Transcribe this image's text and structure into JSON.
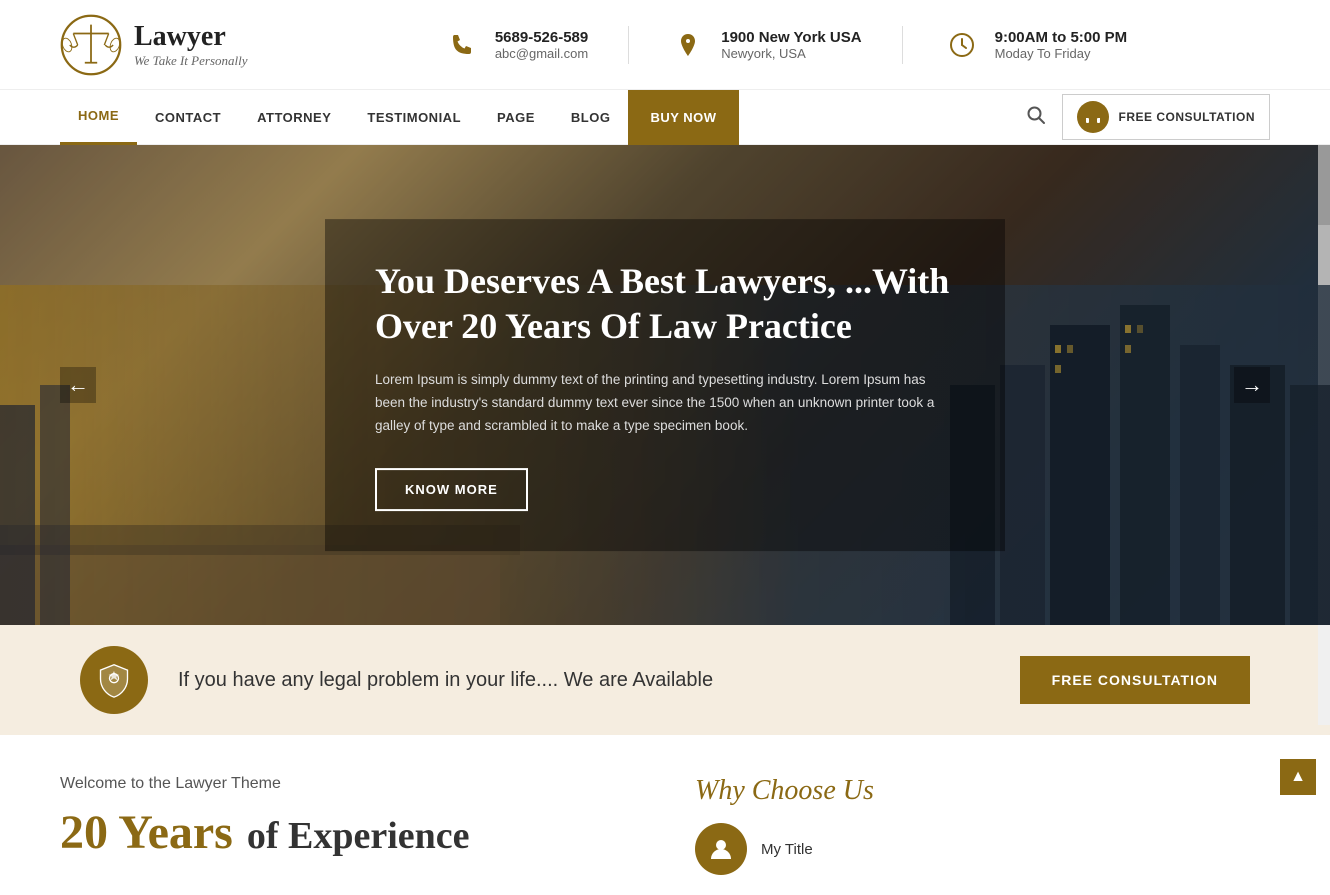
{
  "site": {
    "logo_title": "Lawyer",
    "logo_subtitle": "We Take It Personally"
  },
  "topbar": {
    "phone": {
      "number": "5689-526-589",
      "email": "abc@gmail.com"
    },
    "address": {
      "line1": "1900 New York USA",
      "line2": "Newyork, USA"
    },
    "hours": {
      "time": "9:00AM to 5:00 PM",
      "days": "Moday To Friday"
    }
  },
  "nav": {
    "items": [
      {
        "label": "HOME",
        "active": true
      },
      {
        "label": "CONTACT",
        "active": false
      },
      {
        "label": "ATTORNEY",
        "active": false
      },
      {
        "label": "TESTIMONIAL",
        "active": false
      },
      {
        "label": "PAGE",
        "active": false
      },
      {
        "label": "BLOG",
        "active": false
      }
    ],
    "buy_label": "BUY NOW",
    "consultation_label": "FREE CONSULTATION"
  },
  "hero": {
    "title": "You Deserves A Best Lawyers, ...With Over 20 Years Of Law Practice",
    "description": "Lorem Ipsum is simply dummy text of the printing and typesetting industry. Lorem Ipsum has been the industry's standard dummy text ever since the 1500 when an unknown printer took a galley of type and scrambled it to make a type specimen book.",
    "cta_label": "KNOW MORE",
    "arrow_left": "←",
    "arrow_right": "→"
  },
  "consult_strip": {
    "text": "If you have any legal problem in your life.... We are Available",
    "cta_label": "FREE CONSULTATION"
  },
  "bottom": {
    "welcome_title": "Welcome to the Lawyer Theme",
    "years_number": "20 Years",
    "years_suffix": "of Experience",
    "why_title": "Why Choose Us",
    "my_title_label": "My Title"
  }
}
